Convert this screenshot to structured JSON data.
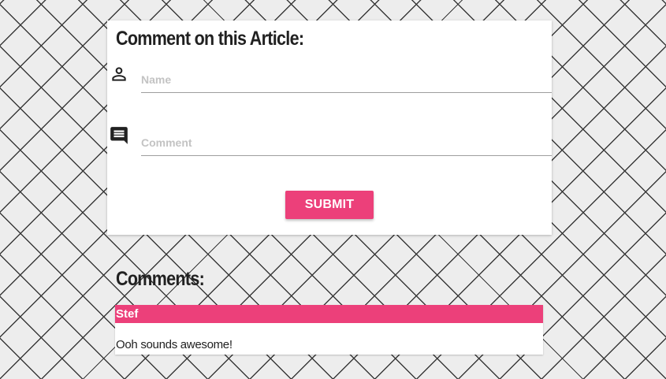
{
  "form": {
    "title": "Comment on this Article:",
    "name_field": {
      "placeholder": "Name",
      "value": "",
      "icon": "person-icon"
    },
    "comment_field": {
      "placeholder": "Comment",
      "value": "",
      "icon": "comment-icon"
    },
    "submit_label": "SUBMIT"
  },
  "comments": {
    "heading": "Comments:",
    "items": [
      {
        "author": "Stef",
        "text": "Ooh sounds awesome!"
      }
    ]
  },
  "colors": {
    "accent": "#ec407a",
    "background": "#ededed",
    "text": "#212121",
    "underline": "#9e9e9e",
    "placeholder": "#c3c3c3"
  }
}
